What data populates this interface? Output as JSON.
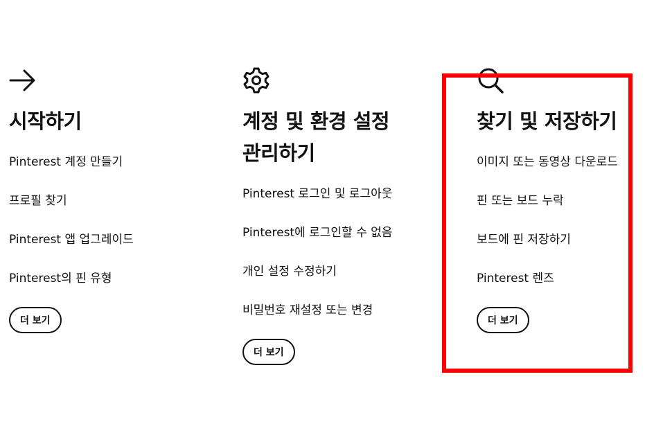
{
  "columns": [
    {
      "icon": "arrow-right-icon",
      "title": "시작하기",
      "links": [
        "Pinterest 계정 만들기",
        "프로필 찾기",
        "Pinterest 앱 업그레이드",
        "Pinterest의 핀 유형"
      ],
      "more_label": "더 보기"
    },
    {
      "icon": "gear-icon",
      "title": "계정 및 환경 설정\n관리하기",
      "links": [
        "Pinterest 로그인 및 로그아웃",
        "Pinterest에 로그인할 수 없음",
        "개인 설정 수정하기",
        "비밀번호 재설정 또는 변경"
      ],
      "more_label": "더 보기"
    },
    {
      "icon": "search-icon",
      "title": "찾기 및 저장하기",
      "links": [
        "이미지 또는 동영상 다운로드",
        "핀 또는 보드 누락",
        "보드에 핀 저장하기",
        "Pinterest 렌즈"
      ],
      "more_label": "더 보기"
    }
  ],
  "colors": {
    "text": "#111111",
    "highlight": "#ff0000",
    "background": "#ffffff"
  }
}
